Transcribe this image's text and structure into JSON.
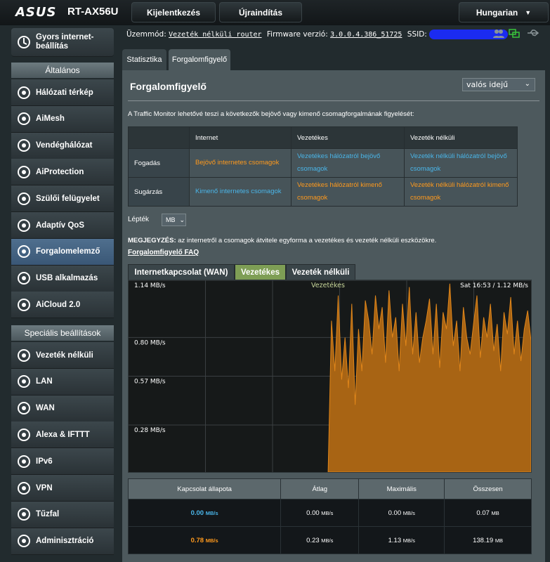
{
  "header": {
    "brand": "ASUS",
    "model": "RT-AX56U",
    "login_button": "Kijelentkezés",
    "reboot_button": "Újraindítás",
    "language": "Hungarian"
  },
  "status": {
    "mode_label": "Üzemmód:",
    "mode_value": "Vezeték nélküli router",
    "firmware_label": "Firmware verzió:",
    "firmware_value": "3.0.0.4.386_51725",
    "ssid_label": "SSID:"
  },
  "sidebar": {
    "quick_setup": "Gyors internet-beállítás",
    "general_header": "Általános",
    "general_items": [
      {
        "label": "Hálózati térkép",
        "icon": "network-map-icon"
      },
      {
        "label": "AiMesh",
        "icon": "aimesh-icon"
      },
      {
        "label": "Vendéghálózat",
        "icon": "guest-network-icon"
      },
      {
        "label": "AiProtection",
        "icon": "aiprotection-icon"
      },
      {
        "label": "Szülői felügyelet",
        "icon": "parental-control-icon"
      },
      {
        "label": "Adaptív QoS",
        "icon": "qos-icon"
      },
      {
        "label": "Forgalomelemző",
        "icon": "traffic-analyzer-icon"
      },
      {
        "label": "USB alkalmazás",
        "icon": "usb-icon"
      },
      {
        "label": "AiCloud 2.0",
        "icon": "aicloud-icon"
      }
    ],
    "advanced_header": "Speciális beállítások",
    "advanced_items": [
      {
        "label": "Vezeték nélküli",
        "icon": "wireless-icon"
      },
      {
        "label": "LAN",
        "icon": "lan-icon"
      },
      {
        "label": "WAN",
        "icon": "wan-icon"
      },
      {
        "label": "Alexa & IFTTT",
        "icon": "alexa-icon"
      },
      {
        "label": "IPv6",
        "icon": "ipv6-icon"
      },
      {
        "label": "VPN",
        "icon": "vpn-icon"
      },
      {
        "label": "Tűzfal",
        "icon": "firewall-icon"
      },
      {
        "label": "Adminisztráció",
        "icon": "admin-icon"
      }
    ]
  },
  "tabs": [
    "Statisztika",
    "Forgalomfigyelő"
  ],
  "main": {
    "title": "Forgalomfigyelő",
    "mode_select": "valós idejű",
    "description": "A Traffic Monitor lehetővé teszi a következők bejövő vagy kimenő csomagforgalmának figyelését:",
    "legend": {
      "headers": [
        "Internet",
        "Vezetékes",
        "Vezeték nélküli"
      ],
      "rows": [
        {
          "label": "Fogadás",
          "cells": [
            "Bejövő internetes csomagok",
            "Vezetékes hálózatról bejövő csomagok",
            "Vezeték nélküli hálózatról bejövő csomagok"
          ]
        },
        {
          "label": "Sugárzás",
          "cells": [
            "Kimenő internetes csomagok",
            "Vezetékes hálózatról kimenő csomagok",
            "Vezeték nélküli hálózatról kimenő csomagok"
          ]
        }
      ]
    },
    "scale_label": "Lépték",
    "scale_value": "MB",
    "note_bold": "MEGJEGYZÉS:",
    "note_text": " az internetről a csomagok átvitele egyforma a vezetékes és vezeték nélküli eszközökre.",
    "faq_link": "Forgalomfigyelő FAQ",
    "subtabs": [
      "Internetkapcsolat (WAN)",
      "Vezetékes",
      "Vezeték nélküli"
    ]
  },
  "chart_data": {
    "type": "area",
    "title": "Vezetékes",
    "top_right_label": "Sat 16:53 / 1.12 MB/s",
    "y_tick_labels": [
      "1.14 MB/s",
      "0.80 MB/s",
      "0.57 MB/s",
      "0.28 MB/s"
    ],
    "y_ticks": [
      1.14,
      0.8,
      0.57,
      0.28
    ],
    "ylim": [
      0,
      1.14
    ],
    "x_count": 120,
    "x_start": 59,
    "series": [
      {
        "color": "#e0861a",
        "values": [
          0.0,
          0.9,
          0.6,
          1.05,
          0.55,
          0.8,
          0.5,
          1.0,
          0.4,
          0.85,
          0.6,
          1.02,
          0.9,
          0.7,
          1.05,
          0.85,
          0.98,
          0.65,
          1.08,
          0.8,
          0.92,
          0.6,
          1.0,
          0.75,
          1.1,
          0.7,
          0.95,
          0.65,
          0.8,
          0.9,
          1.03,
          0.7,
          1.0,
          0.62,
          0.95,
          0.85,
          1.12,
          0.75,
          0.9,
          0.6,
          0.98,
          0.8,
          0.7,
          0.88,
          1.05,
          0.68,
          0.92,
          0.8,
          1.0,
          0.72,
          0.88,
          0.6,
          0.95,
          0.82,
          1.04,
          0.7,
          0.9,
          0.66,
          0.85,
          0.96,
          0.78
        ]
      }
    ]
  },
  "stats": {
    "headers": [
      "Kapcsolat állapota",
      "Átlag",
      "Maximális",
      "Összesen"
    ],
    "rows": [
      {
        "color": "#4ab5e8",
        "status": "0.00",
        "status_unit": "MB/s",
        "avg": "0.00",
        "avg_unit": "MB/s",
        "max": "0.00",
        "max_unit": "MB/s",
        "total": "0.07",
        "total_unit": "MB"
      },
      {
        "color": "#ff9a1d",
        "status": "0.78",
        "status_unit": "MB/s",
        "avg": "0.23",
        "avg_unit": "MB/s",
        "max": "1.13",
        "max_unit": "MB/s",
        "total": "138.19",
        "total_unit": "MB"
      }
    ]
  }
}
